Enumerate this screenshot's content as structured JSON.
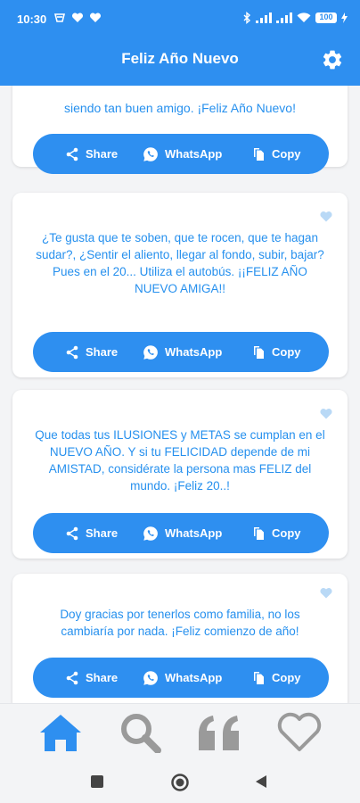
{
  "status_bar": {
    "time": "10:30",
    "battery": "100"
  },
  "app_bar": {
    "title": "Feliz Año Nuevo",
    "settings_icon": "gear-icon"
  },
  "actions": {
    "share": "Share",
    "whatsapp": "WhatsApp",
    "copy": "Copy"
  },
  "cards": [
    {
      "text": "siendo tan buen amigo. ¡Feliz Año Nuevo!"
    },
    {
      "text": "¿Te gusta que te soben, que te rocen, que te hagan sudar?, ¿Sentir el aliento, llegar al fondo, subir, bajar? Pues en el 20... Utiliza el autobús. ¡¡FELIZ AÑO NUEVO AMIGA!!"
    },
    {
      "text": "Que todas tus ILUSIONES y METAS se cumplan en el NUEVO AÑO. Y si tu FELICIDAD depende de mi AMISTAD, considérate la persona mas FELIZ del mundo. ¡Feliz 20..!"
    },
    {
      "text": "Doy gracias por tenerlos como familia, no los cambiaría por nada. ¡Feliz comienzo de año!"
    }
  ],
  "bottom_nav": {
    "items": [
      "home-icon",
      "search-icon",
      "quote-icon",
      "heart-icon"
    ],
    "active": "home-icon"
  },
  "colors": {
    "primary": "#2e8ff0",
    "text_blue": "#2690ee",
    "inactive_icon": "#9a9a9a",
    "heart_light": "#b9d9f6"
  }
}
